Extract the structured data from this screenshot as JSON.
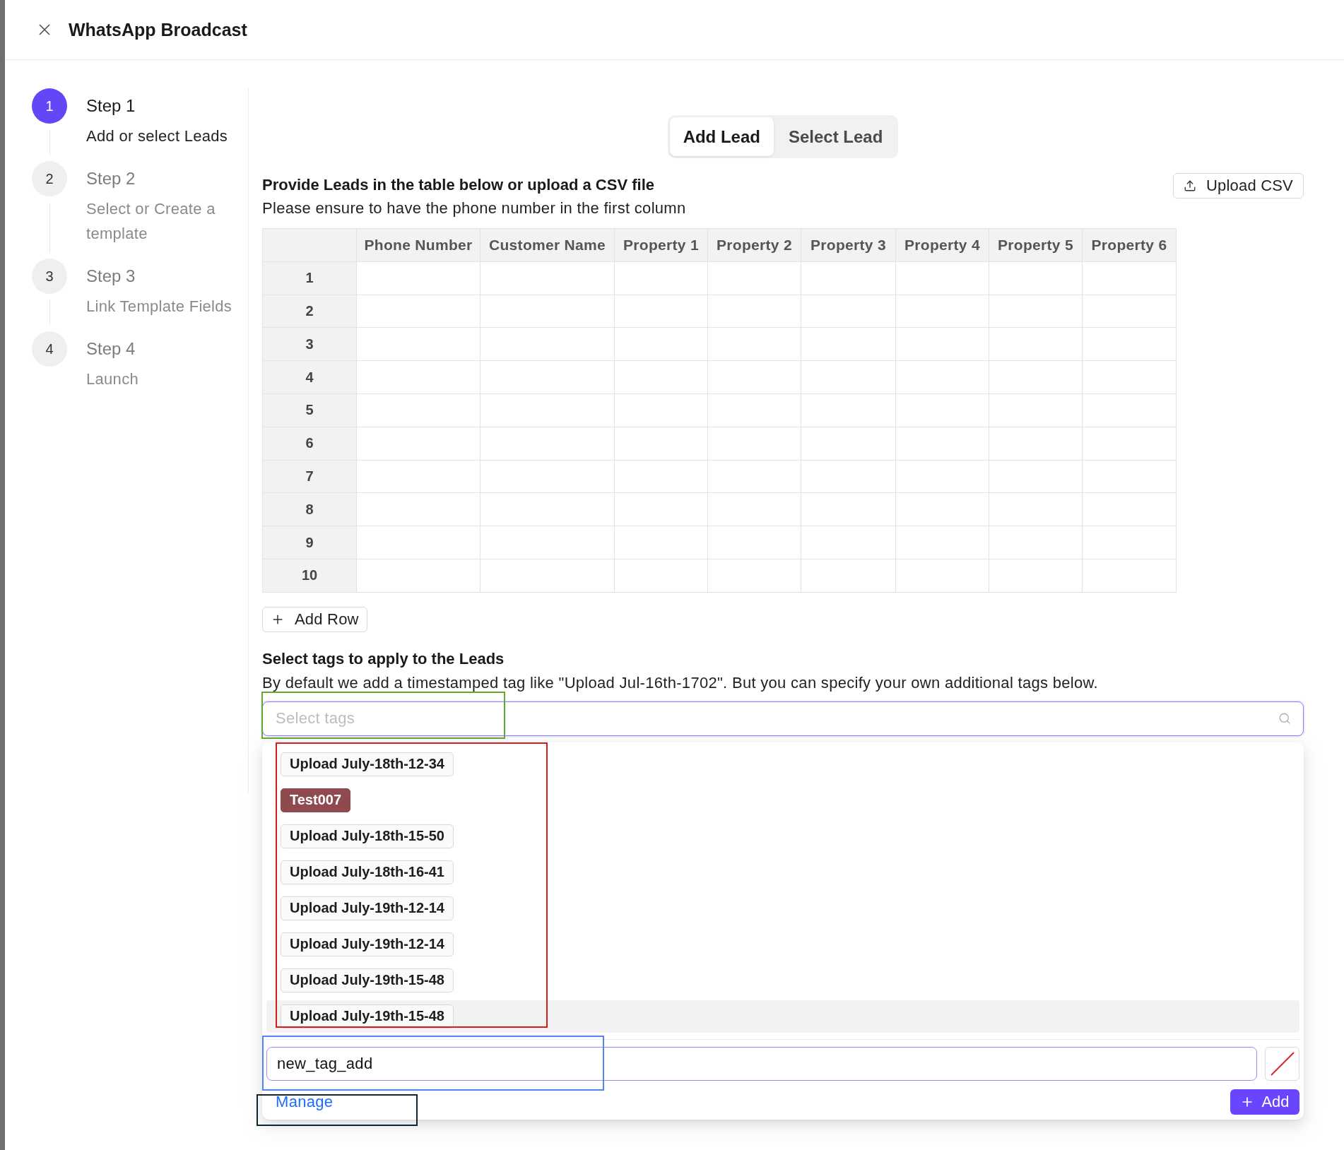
{
  "window": {
    "title": "WhatsApp Broadcast"
  },
  "steps": [
    {
      "number": "1",
      "title": "Step 1",
      "description": "Add or select Leads",
      "current": true
    },
    {
      "number": "2",
      "title": "Step 2",
      "description": "Select or Create a template",
      "current": false
    },
    {
      "number": "3",
      "title": "Step 3",
      "description": "Link Template Fields",
      "current": false
    },
    {
      "number": "4",
      "title": "Step 4",
      "description": "Launch",
      "current": false
    }
  ],
  "tabs": [
    {
      "label": "Add Lead",
      "selected": true
    },
    {
      "label": "Select Lead",
      "selected": false
    }
  ],
  "leads_section": {
    "title": "Provide Leads in the table below or upload a CSV file",
    "description": "Please ensure to have the phone number in the first column",
    "upload_button": "Upload CSV"
  },
  "table": {
    "columns": [
      "Phone Number",
      "Customer Name",
      "Property 1",
      "Property 2",
      "Property 3",
      "Property 4",
      "Property 5",
      "Property 6"
    ],
    "rows": [
      {
        "number": "1"
      },
      {
        "number": "2"
      },
      {
        "number": "3"
      },
      {
        "number": "4"
      },
      {
        "number": "5"
      },
      {
        "number": "6"
      },
      {
        "number": "7"
      },
      {
        "number": "8"
      },
      {
        "number": "9"
      },
      {
        "number": "10"
      }
    ]
  },
  "add_row_button": "Add Row",
  "tags_section": {
    "title": "Select tags to apply to the Leads",
    "description": "By default we add a timestamped tag like \"Upload Jul-16th-1702\". But you can specify your own additional tags below.",
    "search": {
      "placeholder": "Select tags"
    }
  },
  "tag_options": [
    {
      "label": "Upload July-18th-12-34",
      "active": false
    },
    {
      "label": "Test007",
      "color": "#8e4a4f",
      "active": false
    },
    {
      "label": "Upload July-18th-15-50",
      "active": false
    },
    {
      "label": "Upload July-18th-16-41",
      "active": false
    },
    {
      "label": "Upload July-19th-12-14",
      "active": false
    },
    {
      "label": "Upload July-19th-12-14",
      "active": false
    },
    {
      "label": "Upload July-19th-15-48",
      "active": false
    },
    {
      "label": "Upload July-19th-15-48",
      "active": true
    }
  ],
  "new_tag": {
    "value": "new_tag_add"
  },
  "manage_link": "Manage",
  "add_button": "Add",
  "annotation_frames": [
    {
      "kind": "tag-field",
      "color": "#62a92f"
    },
    {
      "kind": "tag-options",
      "color": "#d71c1c"
    },
    {
      "kind": "new-tag-input",
      "color": "#4f86f7"
    },
    {
      "kind": "manage-link",
      "color": "#102431"
    }
  ]
}
